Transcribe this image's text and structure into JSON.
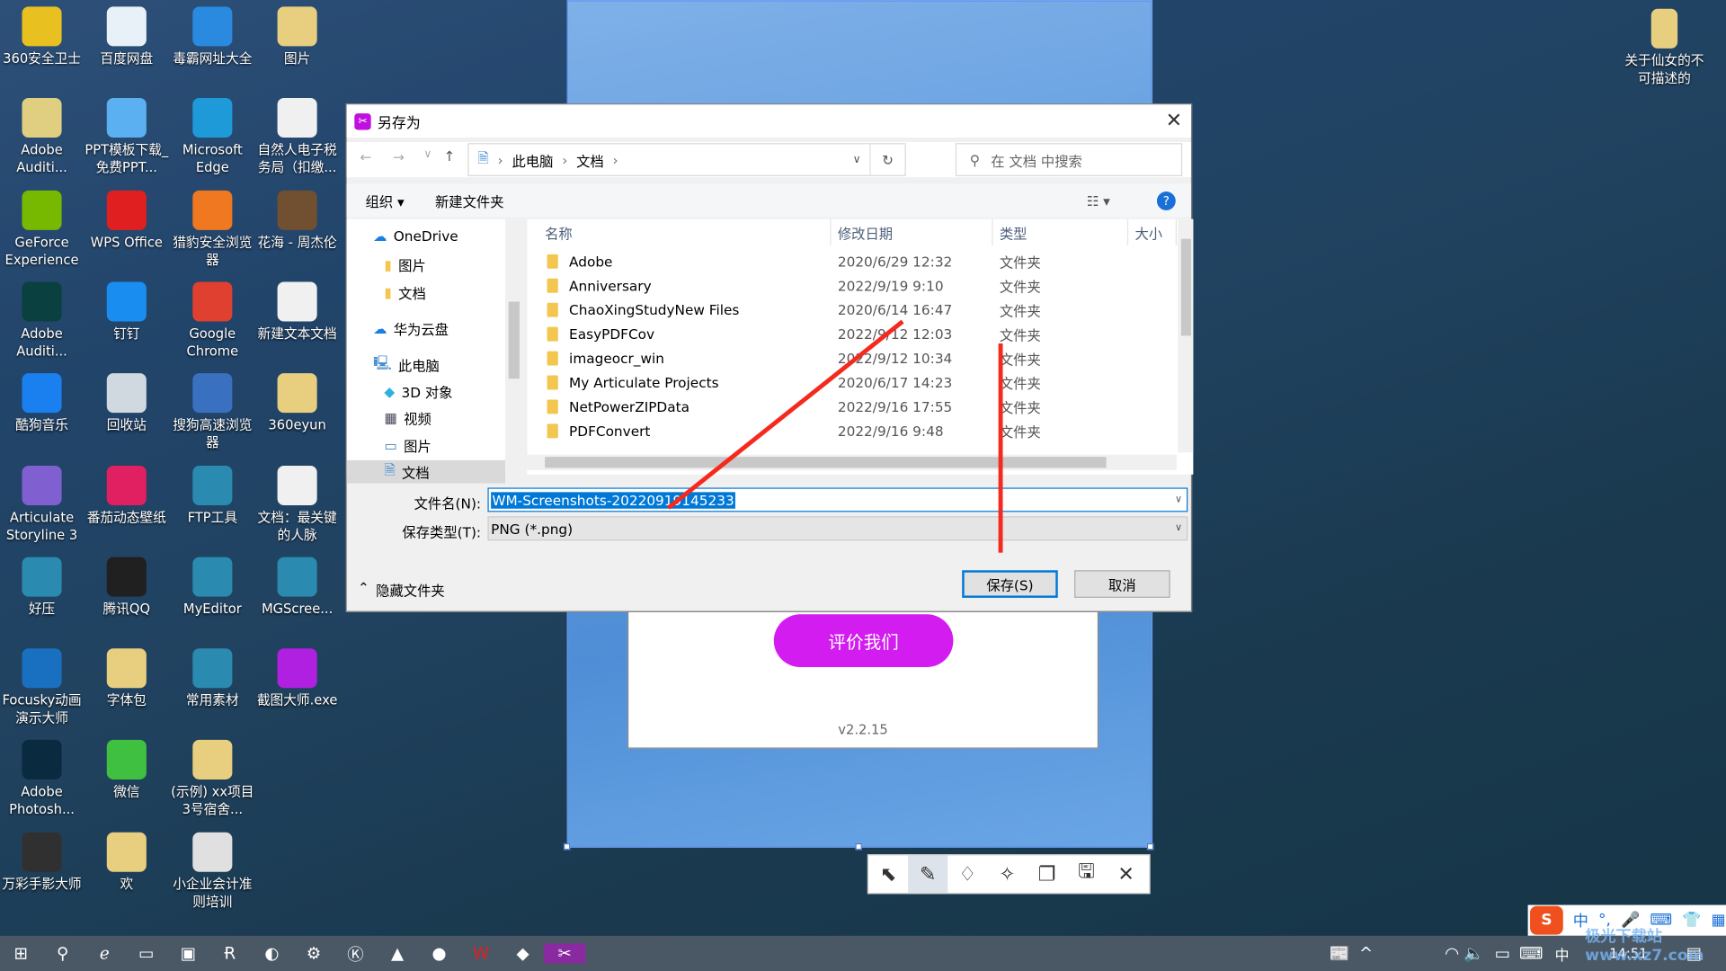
{
  "desktop": {
    "icons": [
      {
        "label": "360安全卫士",
        "color": "#e8c020"
      },
      {
        "label": "百度网盘",
        "color": "#e8f0f8"
      },
      {
        "label": "毒霸网址大全",
        "color": "#2a8ae0"
      },
      {
        "label": "图片",
        "color": "#e8cf80"
      },
      {
        "label": "Adobe Auditi...",
        "color": "#e0cf80"
      },
      {
        "label": "PPT模板下载_免费PPT...",
        "color": "#5ab0f0"
      },
      {
        "label": "Microsoft Edge",
        "color": "#1e9ad8"
      },
      {
        "label": "自然人电子税务局（扣缴...",
        "color": "#f0f0f0"
      },
      {
        "label": "GeForce Experience",
        "color": "#76b900"
      },
      {
        "label": "WPS Office",
        "color": "#e02020"
      },
      {
        "label": "猎豹安全浏览器",
        "color": "#f07820"
      },
      {
        "label": "花海 - 周杰伦",
        "color": "#705030"
      },
      {
        "label": "Adobe Auditi...",
        "color": "#0a4040"
      },
      {
        "label": "钉钉",
        "color": "#1a8ef0"
      },
      {
        "label": "Google Chrome",
        "color": "#e04030"
      },
      {
        "label": "新建文本文档",
        "color": "#f0f0f0"
      },
      {
        "label": "酷狗音乐",
        "color": "#1a80f0"
      },
      {
        "label": "回收站",
        "color": "#d0d8e0"
      },
      {
        "label": "搜狗高速浏览器",
        "color": "#3a70c0"
      },
      {
        "label": "360eyun",
        "color": "#e8cf80"
      },
      {
        "label": "Articulate Storyline 3",
        "color": "#8060d0"
      },
      {
        "label": "番茄动态壁纸",
        "color": "#e02060"
      },
      {
        "label": "FTP工具",
        "color": "#2a8ab0"
      },
      {
        "label": "文档：最关键的人脉",
        "color": "#f0f0f0"
      },
      {
        "label": "好压",
        "color": "#2a8ab0"
      },
      {
        "label": "腾讯QQ",
        "color": "#202020"
      },
      {
        "label": "MyEditor",
        "color": "#2a8ab0"
      },
      {
        "label": "MGScree...",
        "color": "#2a8ab0"
      },
      {
        "label": "Focusky动画演示大师",
        "color": "#1a70c0"
      },
      {
        "label": "字体包",
        "color": "#e8cf80"
      },
      {
        "label": "常用素材",
        "color": "#2a8ab0"
      },
      {
        "label": "截图大师.exe",
        "color": "#b020e0"
      },
      {
        "label": "Adobe Photosh...",
        "color": "#0a2a40"
      },
      {
        "label": "微信",
        "color": "#40c040"
      },
      {
        "label": "(示例) xx项目3号宿舍...",
        "color": "#e8cf80"
      },
      {
        "label": "",
        "color": "#00000000"
      },
      {
        "label": "万彩手影大师",
        "color": "#303030"
      },
      {
        "label": "欢",
        "color": "#e8cf80"
      },
      {
        "label": "小企业会计准则培训",
        "color": "#e0e0e0"
      }
    ],
    "top_right_icon": {
      "label": "关于仙女的不可描述的"
    }
  },
  "app": {
    "rate_button": "评价我们",
    "version": "v2.2.15",
    "toolbar": [
      {
        "icon": "select-arrow-icon",
        "glyph": "⬉"
      },
      {
        "icon": "pen-icon",
        "glyph": "✎"
      },
      {
        "icon": "marker-icon",
        "glyph": "♢"
      },
      {
        "icon": "pin-icon",
        "glyph": "✧"
      },
      {
        "icon": "copy-icon",
        "glyph": "❐"
      },
      {
        "icon": "save-icon",
        "glyph": "🖫"
      },
      {
        "icon": "close-icon",
        "glyph": "✕"
      }
    ]
  },
  "dialog": {
    "title": "另存为",
    "breadcrumb": [
      "此电脑",
      "文档"
    ],
    "search_placeholder": "在 文档 中搜索",
    "organize": "组织 ▾",
    "new_folder": "新建文件夹",
    "nav": [
      {
        "label": "OneDrive",
        "icon": "cloud-icon",
        "indent": 0
      },
      {
        "label": "图片",
        "icon": "folder-icon",
        "indent": 1
      },
      {
        "label": "文档",
        "icon": "folder-icon",
        "indent": 1
      },
      {
        "label": "华为云盘",
        "icon": "cloud-icon",
        "indent": 0
      },
      {
        "label": "此电脑",
        "icon": "computer-icon",
        "indent": 0
      },
      {
        "label": "3D 对象",
        "icon": "cube-icon",
        "indent": 1
      },
      {
        "label": "视频",
        "icon": "video-icon",
        "indent": 1
      },
      {
        "label": "图片",
        "icon": "picture-icon",
        "indent": 1
      },
      {
        "label": "文档",
        "icon": "document-icon",
        "indent": 1
      }
    ],
    "columns": [
      "名称",
      "修改日期",
      "类型",
      "大小"
    ],
    "files": [
      {
        "name": "Adobe",
        "date": "2020/6/29 12:32",
        "type": "文件夹"
      },
      {
        "name": "Anniversary",
        "date": "2022/9/19 9:10",
        "type": "文件夹"
      },
      {
        "name": "ChaoXingStudyNew Files",
        "date": "2020/6/14 16:47",
        "type": "文件夹"
      },
      {
        "name": "EasyPDFCov",
        "date": "2022/9/12 12:03",
        "type": "文件夹"
      },
      {
        "name": "imageocr_win",
        "date": "2022/9/12 10:34",
        "type": "文件夹"
      },
      {
        "name": "My Articulate Projects",
        "date": "2020/6/17 14:23",
        "type": "文件夹"
      },
      {
        "name": "NetPowerZIPData",
        "date": "2022/9/16 17:55",
        "type": "文件夹"
      },
      {
        "name": "PDFConvert",
        "date": "2022/9/16 9:48",
        "type": "文件夹"
      }
    ],
    "filename_label": "文件名(N):",
    "filename_value": "WM-Screenshots-20220919145233",
    "filetype_label": "保存类型(T):",
    "filetype_value": "PNG (*.png)",
    "hide_folders": "隐藏文件夹",
    "save": "保存(S)",
    "cancel": "取消"
  },
  "ime": {
    "chinese": "中",
    "punct": "°,"
  },
  "taskbar": {
    "time": "14:51",
    "tray_lang": "中"
  },
  "watermark": "极光下载站 www.xz7.com",
  "colors": {
    "accent": "#0078d7",
    "annotation_arrow": "#f52a1e",
    "app_button": "#d31cf0"
  }
}
